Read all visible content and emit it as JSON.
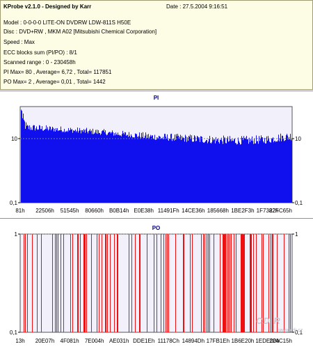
{
  "header": {
    "title": "KProbe v2.1.0 - Designed by Karr",
    "date": "Date : 27.5.2004 9:16:51",
    "lines": [
      "Model : 0-0-0-0 LITE-ON DVDRW LDW-811S   H50E",
      "Disc : DVD+RW , MKM A02 [Mitsubishi Chemical Corporation]",
      "Speed : Max",
      "ECC blocks sum (PI/PO) : 8/1",
      "Scanned range : 0 - 230458h",
      "PI Max= 80 , Average= 6,72 , Total= 117851",
      "PO Max= 2 , Average= 0,01 , Total= 1442"
    ]
  },
  "watermark": {
    "logo": "CD R",
    "url": "www.cdr.cz"
  },
  "colors": {
    "pi": "#1010ee",
    "po": "#ee1010",
    "plot_bg": "#f2f0fb",
    "title": "#00008b",
    "dash": "#7a7a7a"
  },
  "chart_data": [
    {
      "type": "bar",
      "title": "PI",
      "scale": "log",
      "ylim": [
        0.1,
        100
      ],
      "y_ticks": [
        "10",
        "0,1"
      ],
      "x_tick_labels": [
        "81h",
        "22506h",
        "51545h",
        "80660h",
        "B0B14h",
        "E0E38h",
        "11491Fh",
        "14CE36h",
        "185668h",
        "1BE2F3h",
        "1F7382h",
        "22FC65h"
      ],
      "x_range": [
        "0h",
        "230458h"
      ],
      "reference_line": 10,
      "profile": [
        {
          "x_frac": 0.0,
          "max": 80,
          "avg": 22
        },
        {
          "x_frac": 0.02,
          "max": 30,
          "avg": 18
        },
        {
          "x_frac": 0.1,
          "max": 26,
          "avg": 17
        },
        {
          "x_frac": 0.2,
          "max": 23,
          "avg": 15
        },
        {
          "x_frac": 0.3,
          "max": 20,
          "avg": 13
        },
        {
          "x_frac": 0.4,
          "max": 17,
          "avg": 11
        },
        {
          "x_frac": 0.5,
          "max": 15,
          "avg": 9
        },
        {
          "x_frac": 0.6,
          "max": 14,
          "avg": 8
        },
        {
          "x_frac": 0.7,
          "max": 13,
          "avg": 7
        },
        {
          "x_frac": 0.8,
          "max": 12,
          "avg": 6.5
        },
        {
          "x_frac": 0.9,
          "max": 13,
          "avg": 7
        },
        {
          "x_frac": 1.0,
          "max": 17,
          "avg": 9
        }
      ]
    },
    {
      "type": "bar",
      "title": "PO",
      "scale": "log",
      "ylim": [
        0.1,
        1
      ],
      "y_ticks": [
        "1",
        "0,1"
      ],
      "x_tick_labels": [
        "13h",
        "20E07h",
        "4F081h",
        "7E004h",
        "AE031h",
        "DDE1Eh",
        "11178Ch",
        "14894Dh",
        "17FB1Eh",
        "1B6E20h",
        "1EDE00h",
        "224C15h"
      ],
      "x_range": [
        "0h",
        "230458h"
      ],
      "reference_line": 1,
      "max_value": 2,
      "spike_value": 1
    }
  ]
}
